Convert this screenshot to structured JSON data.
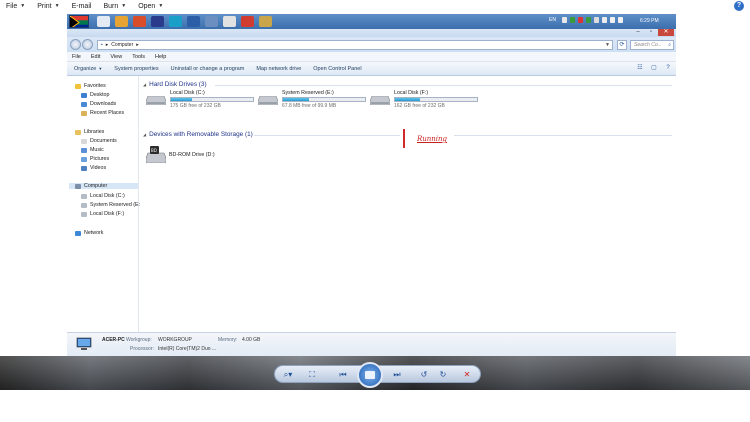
{
  "viewer_menu": {
    "file": "File",
    "print": "Print",
    "email": "E-mail",
    "burn": "Burn",
    "open": "Open",
    "help_icon": "?"
  },
  "taskbar": {
    "language": "EN",
    "clock": "6:29 PM"
  },
  "window": {
    "address": "Computer",
    "search_placeholder": "Search Co...",
    "menu": [
      "File",
      "Edit",
      "View",
      "Tools",
      "Help"
    ],
    "commands": [
      "Organize",
      "System properties",
      "Uninstall or change a program",
      "Map network drive",
      "Open Control Panel"
    ]
  },
  "navpane": {
    "favorites": "Favorites",
    "desktop": "Desktop",
    "downloads": "Downloads",
    "recent": "Recent Places",
    "libraries": "Libraries",
    "documents": "Documents",
    "music": "Music",
    "pictures": "Pictures",
    "videos": "Videos",
    "computer": "Computer",
    "local_c": "Local Disk (C:)",
    "system_reserved": "System Reserved (E:",
    "local_f": "Local Disk (F:)",
    "network": "Network"
  },
  "content": {
    "hdd_header": "Hard Disk Drives (3)",
    "removable_header": "Devices with Removable Storage (1)",
    "drives": [
      {
        "name": "Local Disk (C:)",
        "free": "175 GB free of 232 GB",
        "used_fraction": 0.25
      },
      {
        "name": "System Reserved (E:)",
        "free": "67.8 MB free of 99.9 MB",
        "used_fraction": 0.32
      },
      {
        "name": "Local Disk (F:)",
        "free": "162 GB free of 232 GB",
        "used_fraction": 0.3
      }
    ],
    "bd_drive": "BD-ROM Drive (D:)",
    "annotation": "Running"
  },
  "details": {
    "pc_name": "ACER-PC",
    "workgroup_label": "Workgroup:",
    "workgroup": "WORKGROUP",
    "memory_label": "Memory:",
    "memory": "4.00 GB",
    "processor_label": "Processor:",
    "processor": "Intel(R) Core(TM)2 Duo ..."
  },
  "colors": {
    "accent": "#2b9ad1",
    "annotation": "#c92222",
    "header_text": "#1e3287"
  }
}
